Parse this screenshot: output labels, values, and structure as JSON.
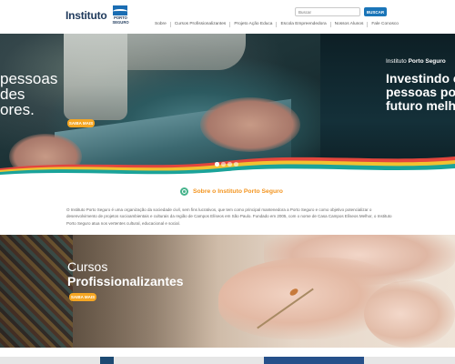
{
  "header": {
    "logo_text": "Instituto",
    "logo_mark_text": "PORTO SEGURO",
    "search_placeholder": "Buscar",
    "search_button": "BUSCAR",
    "nav": [
      "Sobre",
      "Cursos Profissionalizantes",
      "Projeto Ação Educa",
      "Escola Empreendedora",
      "Nossos Alunos",
      "Fale Conosco"
    ]
  },
  "hero": {
    "left_lines": [
      "pessoas",
      "des",
      "ores."
    ],
    "right_brand_prefix": "Instituto",
    "right_brand_bold": "Porto Seguro",
    "right_title_lines": [
      "Investindo em",
      "pessoas por u",
      "futuro melho"
    ],
    "right_button": "SAIBA MAIS",
    "slides_total": 4,
    "slide_active": 1
  },
  "about": {
    "title": "Sobre o Instituto Porto Seguro",
    "body": "O Instituto Porto Seguro é uma organização da sociedade civil, sem fins lucrativos, que tem como principal mantenedora a Porto Seguro e como objetivo potencializar o desenvolvimento de projetos socioambientais e culturais da região de Campos Elíseos em São Paulo. Fundado em 2005, com o nome de Casa Campos Elíseos Melhor, o Instituto Porto Seguro atua nos vertentes cultural, educacional e social."
  },
  "courses": {
    "title_light": "Cursos",
    "title_bold": "Profissionalizantes",
    "button": "SAIBA MAIS"
  },
  "colors": {
    "accent_orange": "#f5a623",
    "about_title": "#f3941e",
    "about_icon": "#45b38b",
    "brand_blue": "#1a75b8",
    "wave_teal": "#1aa39a",
    "wave_yellow": "#f2c230",
    "wave_red": "#e4463d"
  },
  "icons": {
    "about": "circle-icon",
    "logo": "porto-seguro-logo-icon"
  }
}
